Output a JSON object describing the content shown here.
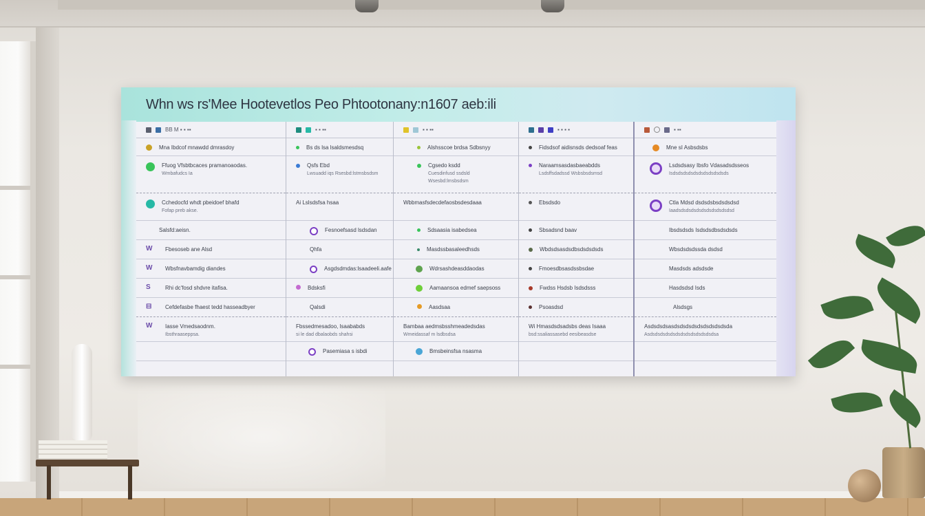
{
  "board": {
    "title": "Whn ws rs'Mee Hootevetlos Peo Phtootonany:n1607 aeb:ili",
    "columns": [
      {
        "head": "BB M ▪ ▪ ▪▪",
        "rows": [
          {
            "text": "Mna Ibdcof mnawdd dmrasdoy",
            "sub": ""
          },
          {
            "text": "Ffuog Vfsbtbcaces pramanoaodas.",
            "sub": "Wmbafudcs Ia"
          },
          {
            "text": "Cchedocfd whdt pbeidoef bhafd",
            "sub": "Fofap preb akse."
          },
          {
            "text": "Salsfd:aeisn.",
            "sub": ""
          },
          {
            "text": "Fbesoseb ane Alsd",
            "sub": ""
          },
          {
            "text": "Wbsfnavbamdig diandes",
            "sub": ""
          },
          {
            "text": "Rhi dc'fosd shdvre itafisa.",
            "sub": ""
          },
          {
            "text": "Cefdefasbe fhaest tedd hasseadbyer",
            "sub": ""
          },
          {
            "text": "Iasse Vmedsaodnm.",
            "sub": "Ibsthraaseppsa."
          },
          {
            "text": "",
            "sub": ""
          }
        ]
      },
      {
        "head": "▪ ▪ ▪▪",
        "rows": [
          {
            "text": "Bs ds lsa lsaldsmesdsq",
            "sub": ""
          },
          {
            "text": "Qsfs Ebd",
            "sub": "Lwsuadd iqs\nRsesbd:lstmsbsdsm"
          },
          {
            "text": "Ai Lslsdsfsa hsaa",
            "sub": ""
          },
          {
            "text": "Fesnoefsasd lsdsdan",
            "sub": ""
          },
          {
            "text": "Qhfa",
            "sub": ""
          },
          {
            "text": "Asgdsdmdas:lsaadeeli.aafe",
            "sub": ""
          },
          {
            "text": "Bdsksfi",
            "sub": ""
          },
          {
            "text": "Qalsdi",
            "sub": ""
          },
          {
            "text": "Fbssedmesadoo, lsaababds",
            "sub": "si le dad dbalaobds shahsi"
          },
          {
            "text": "Pasemiasa s isbdi",
            "sub": ""
          }
        ]
      },
      {
        "head": "▪ ▪ ▪▪",
        "rows": [
          {
            "text": "Alshsscoe brdsa Sdbsnyy",
            "sub": ""
          },
          {
            "text": "Cgsedo ksdd",
            "sub": "Cuesdinfusd ssdsld\nWsesbd:lmsbsdsm"
          },
          {
            "text": "Wbbmasfsdecdefaosbsdesdaaa",
            "sub": ""
          },
          {
            "text": "Sdsaasia isabedsea",
            "sub": ""
          },
          {
            "text": "Masdssbasaleedhsds",
            "sub": ""
          },
          {
            "text": "Wdrsashdeasddaodas",
            "sub": ""
          },
          {
            "text": "Aamaansoa edmef saepsoss",
            "sub": ""
          },
          {
            "text": "Aasdsaa",
            "sub": ""
          },
          {
            "text": "Bambaa aedmsbsshmeadedsdas",
            "sub": "Wmeidassaf m lsdbsdsa"
          },
          {
            "text": "Bmsbeinsfsa nsasma",
            "sub": ""
          }
        ]
      },
      {
        "head": "▪ ▪ ▪ ▪",
        "rows": [
          {
            "text": "Fidsdsof aidisnsds dedsoaf feas",
            "sub": ""
          },
          {
            "text": "Naraamsasdasbaeabdds",
            "sub": "Lsdsffsdadssd\nWsbsbsdsmsd"
          },
          {
            "text": "Ebsdsdo",
            "sub": ""
          },
          {
            "text": "Sbsadsnd baav",
            "sub": ""
          },
          {
            "text": "Wbdsdsasdsdbsdsdsdsds",
            "sub": ""
          },
          {
            "text": "Fmoesdbsasdssbsdae",
            "sub": ""
          },
          {
            "text": "Fwdss Hsdsb Isdsdsss",
            "sub": ""
          },
          {
            "text": "Psoasdsd",
            "sub": ""
          },
          {
            "text": "Wi Hmasdsdsadsbs deas Isaaa",
            "sub": "bsd:ssaliassasebd eesibeasdse"
          },
          {
            "text": "",
            "sub": ""
          }
        ]
      },
      {
        "head": "▪ ▪▪",
        "rows": [
          {
            "text": "Mne sI Asbsdsbs",
            "sub": ""
          },
          {
            "text": "Lsdsdsasy Ibsfo Vdasadsdsseos",
            "sub": "Isdsdsdsdsdsdsdsdsdsdsds"
          },
          {
            "text": "Ctla Mdsd dsdsdsbsdsdsdsd",
            "sub": "Iaadsdsdsdsdsdsdsdsdsdsdsd"
          },
          {
            "text": "Ibsdsdsds Isdsdsdbsdsdsds",
            "sub": ""
          },
          {
            "text": "Wbsdsdsdssda dsdsd",
            "sub": ""
          },
          {
            "text": "Masdsds adsdsde",
            "sub": ""
          },
          {
            "text": "Hasdsdsd Isds",
            "sub": ""
          },
          {
            "text": "Alsdsgs",
            "sub": ""
          },
          {
            "text": "Asdsdsdsasdsdsdsdsdsdsdsdsdsda",
            "sub": "Asdsdsdsdsdsdsdsdsdsdsdsdsdsa"
          },
          {
            "text": "",
            "sub": ""
          }
        ]
      }
    ]
  },
  "colors": {
    "header_start": "#a9e3dc",
    "header_end": "#bfe4ef",
    "board_bg": "#f1f1f6",
    "accent_purple": "#7b3fc4",
    "accent_teal": "#27b9a6",
    "accent_green": "#39c45a",
    "accent_orange": "#e59b25",
    "accent_blue": "#3a7bd5"
  }
}
